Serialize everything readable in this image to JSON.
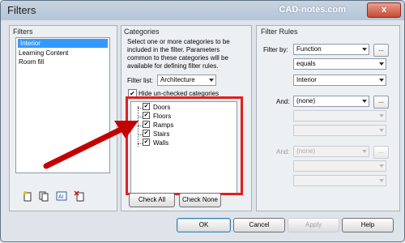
{
  "window": {
    "title": "Filters",
    "watermark": "CAD-notes.com",
    "close": "x"
  },
  "filters": {
    "label": "Filters",
    "items": [
      "Interior",
      "Learning Content",
      "Room fill"
    ],
    "selected": "Interior"
  },
  "categories": {
    "label": "Categories",
    "description": "Select one or more categories to be included in the filter. Parameters common to these categories will be available for defining filter rules.",
    "filter_list_label": "Filter list:",
    "filter_list_value": "Architecture",
    "hide_unchecked_label": "Hide un-checked categories",
    "hide_unchecked": true,
    "items": [
      {
        "label": "Doors",
        "checked": true
      },
      {
        "label": "Floors",
        "checked": true
      },
      {
        "label": "Ramps",
        "checked": true
      },
      {
        "label": "Stairs",
        "checked": true
      },
      {
        "label": "Walls",
        "checked": true
      }
    ],
    "check_all": "Check All",
    "check_none": "Check None"
  },
  "rules": {
    "label": "Filter Rules",
    "filter_by_label": "Filter by:",
    "filter_by_value": "Function",
    "operator_value": "equals",
    "value_value": "Interior",
    "and1_label": "And:",
    "and1_value": "(none)",
    "and2_label": "And:",
    "and2_value": "(none)",
    "ellipsis": "..."
  },
  "buttons": {
    "ok": "OK",
    "cancel": "Cancel",
    "apply": "Apply",
    "help": "Help"
  },
  "colors": {
    "highlight": "#e11f1f",
    "arrow": "#e11f1f",
    "selection": "#3399ff"
  },
  "icons": [
    "new-filter-icon",
    "duplicate-filter-icon",
    "rename-filter-icon",
    "delete-filter-icon"
  ]
}
